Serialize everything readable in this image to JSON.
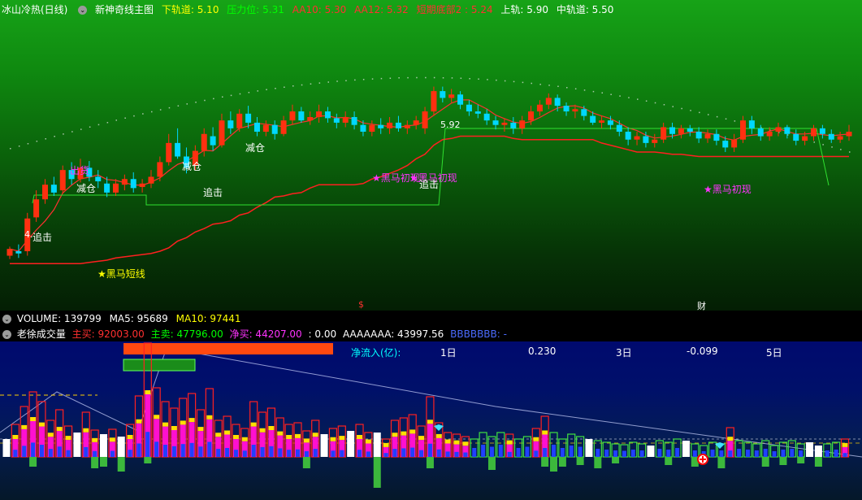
{
  "main_header": {
    "title": "冰山冷热(日线)",
    "indicator": "新神奇线主图",
    "items": [
      {
        "label": "下轨道: 5.10",
        "color": "#ffff00"
      },
      {
        "label": "压力位: 5.31",
        "color": "#00ff00"
      },
      {
        "label": "AA10: 5.30",
        "color": "#ff3030"
      },
      {
        "label": "AA12: 5.32",
        "color": "#ff3030"
      },
      {
        "label": "短期底部2 : 5.24",
        "color": "#ff3030"
      },
      {
        "label": "上轨: 5.90",
        "color": "#ffffff"
      },
      {
        "label": "中轨道: 5.50",
        "color": "#ffffff"
      }
    ]
  },
  "chart_labels": {
    "heima_short": "★黑马短线",
    "heima_appear_1": "★黑马初现",
    "heima_appear_2": "★黑马初现",
    "heima_appear_3": "★黑马初现",
    "zhuiji_1": "追击",
    "zhuiji_2": "追击",
    "zhuiji_3": "追击",
    "jiancang_1": "减仓",
    "jiancang_2": "减仓",
    "jiancang_3": "减仓",
    "chuhuo": "出货",
    "high_price": "5.92",
    "low_price": "4.",
    "marker_s": "$",
    "marker_cai": "财"
  },
  "volume_header": {
    "volume": "VOLUME: 139799",
    "ma5": "MA5: 95689",
    "ma10": "MA10: 97441"
  },
  "sub_header": {
    "title": "老徐成交量",
    "main_buy": "主买: 92003.00",
    "main_sell": "主卖: 47796.00",
    "net_buy": "净买: 44207.00",
    "zero": ": 0.00",
    "aaa": "AAAAAAA: 43997.56",
    "bbb": "BBBBBBB: -"
  },
  "net_inflow": {
    "label": "净流入(亿):",
    "d1": "1日",
    "v1": "0.230",
    "d3": "3日",
    "v3": "-0.099",
    "d5": "5日"
  },
  "chart_data": {
    "type": "candlestick",
    "ylim": [
      4.2,
      6.4
    ],
    "candles": [
      [
        4.42,
        4.48,
        4.39,
        4.5
      ],
      [
        4.46,
        4.44,
        4.4,
        4.52
      ],
      [
        4.46,
        4.75,
        4.42,
        4.8
      ],
      [
        4.76,
        4.92,
        4.72,
        5.0
      ],
      [
        4.92,
        5.05,
        4.88,
        5.1
      ],
      [
        5.05,
        4.98,
        4.95,
        5.12
      ],
      [
        5.0,
        5.18,
        4.97,
        5.22
      ],
      [
        5.18,
        5.1,
        5.05,
        5.25
      ],
      [
        5.1,
        5.2,
        5.07,
        5.28
      ],
      [
        5.2,
        5.12,
        5.08,
        5.26
      ],
      [
        5.12,
        5.08,
        5.02,
        5.18
      ],
      [
        5.06,
        4.98,
        4.94,
        5.12
      ],
      [
        4.98,
        5.06,
        4.95,
        5.1
      ],
      [
        5.05,
        5.1,
        5.0,
        5.14
      ],
      [
        5.1,
        5.02,
        4.98,
        5.16
      ],
      [
        5.03,
        5.06,
        4.98,
        5.1
      ],
      [
        5.06,
        5.12,
        5.02,
        5.18
      ],
      [
        5.12,
        5.25,
        5.08,
        5.3
      ],
      [
        5.25,
        5.42,
        5.22,
        5.5
      ],
      [
        5.42,
        5.3,
        5.28,
        5.55
      ],
      [
        5.3,
        5.2,
        5.15,
        5.38
      ],
      [
        5.22,
        5.35,
        5.18,
        5.4
      ],
      [
        5.35,
        5.5,
        5.3,
        5.55
      ],
      [
        5.48,
        5.4,
        5.35,
        5.56
      ],
      [
        5.4,
        5.62,
        5.38,
        5.68
      ],
      [
        5.62,
        5.55,
        5.5,
        5.7
      ],
      [
        5.55,
        5.68,
        5.52,
        5.72
      ],
      [
        5.68,
        5.6,
        5.55,
        5.75
      ],
      [
        5.6,
        5.52,
        5.48,
        5.65
      ],
      [
        5.52,
        5.58,
        5.48,
        5.62
      ],
      [
        5.58,
        5.5,
        5.45,
        5.62
      ],
      [
        5.5,
        5.62,
        5.48,
        5.66
      ],
      [
        5.62,
        5.7,
        5.58,
        5.76
      ],
      [
        5.7,
        5.62,
        5.6,
        5.74
      ],
      [
        5.62,
        5.65,
        5.58,
        5.7
      ],
      [
        5.65,
        5.7,
        5.6,
        5.76
      ],
      [
        5.7,
        5.64,
        5.6,
        5.74
      ],
      [
        5.64,
        5.6,
        5.55,
        5.68
      ],
      [
        5.6,
        5.65,
        5.56,
        5.7
      ],
      [
        5.65,
        5.58,
        5.54,
        5.7
      ],
      [
        5.58,
        5.52,
        5.48,
        5.62
      ],
      [
        5.52,
        5.58,
        5.48,
        5.62
      ],
      [
        5.58,
        5.55,
        5.5,
        5.64
      ],
      [
        5.55,
        5.6,
        5.5,
        5.65
      ],
      [
        5.6,
        5.55,
        5.52,
        5.66
      ],
      [
        5.55,
        5.58,
        5.5,
        5.62
      ],
      [
        5.58,
        5.62,
        5.54,
        5.66
      ],
      [
        5.55,
        5.7,
        5.5,
        5.74
      ],
      [
        5.7,
        5.88,
        5.66,
        5.92
      ],
      [
        5.88,
        5.82,
        5.78,
        5.92
      ],
      [
        5.82,
        5.85,
        5.78,
        5.9
      ],
      [
        5.85,
        5.76,
        5.72,
        5.88
      ],
      [
        5.76,
        5.7,
        5.66,
        5.8
      ],
      [
        5.7,
        5.68,
        5.64,
        5.76
      ],
      [
        5.68,
        5.62,
        5.58,
        5.72
      ],
      [
        5.62,
        5.58,
        5.54,
        5.66
      ],
      [
        5.58,
        5.6,
        5.52,
        5.64
      ],
      [
        5.6,
        5.55,
        5.5,
        5.65
      ],
      [
        5.55,
        5.62,
        5.5,
        5.66
      ],
      [
        5.62,
        5.7,
        5.58,
        5.75
      ],
      [
        5.7,
        5.76,
        5.66,
        5.8
      ],
      [
        5.76,
        5.82,
        5.72,
        5.86
      ],
      [
        5.82,
        5.75,
        5.7,
        5.85
      ],
      [
        5.75,
        5.7,
        5.66,
        5.78
      ],
      [
        5.7,
        5.72,
        5.64,
        5.76
      ],
      [
        5.72,
        5.66,
        5.62,
        5.75
      ],
      [
        5.66,
        5.6,
        5.58,
        5.7
      ],
      [
        5.6,
        5.62,
        5.55,
        5.66
      ],
      [
        5.62,
        5.58,
        5.54,
        5.66
      ],
      [
        5.58,
        5.52,
        5.48,
        5.62
      ],
      [
        5.52,
        5.45,
        5.4,
        5.56
      ],
      [
        5.45,
        5.48,
        5.4,
        5.52
      ],
      [
        5.48,
        5.42,
        5.38,
        5.52
      ],
      [
        5.42,
        5.45,
        5.38,
        5.5
      ],
      [
        5.45,
        5.56,
        5.42,
        5.6
      ],
      [
        5.56,
        5.5,
        5.46,
        5.6
      ],
      [
        5.5,
        5.55,
        5.46,
        5.58
      ],
      [
        5.55,
        5.52,
        5.48,
        5.58
      ],
      [
        5.52,
        5.46,
        5.42,
        5.56
      ],
      [
        5.46,
        5.5,
        5.42,
        5.54
      ],
      [
        5.5,
        5.44,
        5.4,
        5.54
      ],
      [
        5.44,
        5.38,
        5.34,
        5.48
      ],
      [
        5.38,
        5.45,
        5.34,
        5.5
      ],
      [
        5.45,
        5.62,
        5.42,
        5.66
      ],
      [
        5.62,
        5.55,
        5.5,
        5.66
      ],
      [
        5.55,
        5.48,
        5.44,
        5.58
      ],
      [
        5.48,
        5.52,
        5.44,
        5.56
      ],
      [
        5.52,
        5.56,
        5.48,
        5.6
      ],
      [
        5.56,
        5.5,
        5.46,
        5.58
      ],
      [
        5.5,
        5.44,
        5.4,
        5.54
      ],
      [
        5.44,
        5.48,
        5.4,
        5.52
      ],
      [
        5.48,
        5.55,
        5.44,
        5.58
      ],
      [
        5.55,
        5.5,
        5.46,
        5.58
      ],
      [
        5.5,
        5.45,
        5.42,
        5.54
      ],
      [
        5.45,
        5.48,
        5.42,
        5.52
      ],
      [
        5.48,
        5.52,
        5.44,
        5.58
      ]
    ],
    "volume": [
      {
        "h": 22,
        "c": "w"
      },
      {
        "h": 40,
        "c": "r"
      },
      {
        "h": 62,
        "c": "r"
      },
      {
        "h": 80,
        "c": "r"
      },
      {
        "h": 68,
        "c": "r"
      },
      {
        "h": 45,
        "c": "r"
      },
      {
        "h": 58,
        "c": "r"
      },
      {
        "h": 38,
        "c": "r"
      },
      {
        "h": 30,
        "c": "w"
      },
      {
        "h": 55,
        "c": "r"
      },
      {
        "h": 33,
        "c": "r"
      },
      {
        "h": 28,
        "c": "w"
      },
      {
        "h": 34,
        "c": "r"
      },
      {
        "h": 25,
        "c": "w"
      },
      {
        "h": 40,
        "c": "r"
      },
      {
        "h": 75,
        "c": "r"
      },
      {
        "h": 140,
        "c": "r"
      },
      {
        "h": 85,
        "c": "r"
      },
      {
        "h": 68,
        "c": "r"
      },
      {
        "h": 60,
        "c": "r"
      },
      {
        "h": 72,
        "c": "r"
      },
      {
        "h": 78,
        "c": "r"
      },
      {
        "h": 58,
        "c": "r"
      },
      {
        "h": 84,
        "c": "r"
      },
      {
        "h": 45,
        "c": "r"
      },
      {
        "h": 50,
        "c": "r"
      },
      {
        "h": 40,
        "c": "r"
      },
      {
        "h": 35,
        "c": "r"
      },
      {
        "h": 68,
        "c": "r"
      },
      {
        "h": 55,
        "c": "r"
      },
      {
        "h": 60,
        "c": "r"
      },
      {
        "h": 48,
        "c": "r"
      },
      {
        "h": 40,
        "c": "r"
      },
      {
        "h": 42,
        "c": "r"
      },
      {
        "h": 32,
        "c": "r"
      },
      {
        "h": 45,
        "c": "r"
      },
      {
        "h": 28,
        "c": "w"
      },
      {
        "h": 35,
        "c": "r"
      },
      {
        "h": 38,
        "c": "r"
      },
      {
        "h": 32,
        "c": "w"
      },
      {
        "h": 40,
        "c": "r"
      },
      {
        "h": 30,
        "c": "r"
      },
      {
        "h": 30,
        "c": "w"
      },
      {
        "h": 22,
        "c": "r"
      },
      {
        "h": 45,
        "c": "r"
      },
      {
        "h": 48,
        "c": "r"
      },
      {
        "h": 52,
        "c": "r"
      },
      {
        "h": 38,
        "c": "r"
      },
      {
        "h": 74,
        "c": "r"
      },
      {
        "h": 42,
        "c": "r"
      },
      {
        "h": 30,
        "c": "r"
      },
      {
        "h": 28,
        "c": "r"
      },
      {
        "h": 25,
        "c": "r"
      },
      {
        "h": 22,
        "c": "g"
      },
      {
        "h": 30,
        "c": "g"
      },
      {
        "h": 25,
        "c": "g"
      },
      {
        "h": 30,
        "c": "g"
      },
      {
        "h": 28,
        "c": "r"
      },
      {
        "h": 22,
        "c": "g"
      },
      {
        "h": 25,
        "c": "g"
      },
      {
        "h": 35,
        "c": "r"
      },
      {
        "h": 50,
        "c": "r"
      },
      {
        "h": 30,
        "c": "g"
      },
      {
        "h": 22,
        "c": "g"
      },
      {
        "h": 28,
        "c": "g"
      },
      {
        "h": 25,
        "c": "g"
      },
      {
        "h": 22,
        "c": "w"
      },
      {
        "h": 20,
        "c": "g"
      },
      {
        "h": 18,
        "c": "g"
      },
      {
        "h": 16,
        "c": "g"
      },
      {
        "h": 15,
        "c": "g"
      },
      {
        "h": 18,
        "c": "g"
      },
      {
        "h": 16,
        "c": "g"
      },
      {
        "h": 14,
        "c": "w"
      },
      {
        "h": 20,
        "c": "g"
      },
      {
        "h": 18,
        "c": "g"
      },
      {
        "h": 22,
        "c": "g"
      },
      {
        "h": 20,
        "c": "w"
      },
      {
        "h": 16,
        "c": "g"
      },
      {
        "h": 14,
        "c": "g"
      },
      {
        "h": 18,
        "c": "g"
      },
      {
        "h": 16,
        "c": "g"
      },
      {
        "h": 36,
        "c": "r"
      },
      {
        "h": 20,
        "c": "g"
      },
      {
        "h": 18,
        "c": "g"
      },
      {
        "h": 16,
        "c": "g"
      },
      {
        "h": 20,
        "c": "g"
      },
      {
        "h": 14,
        "c": "g"
      },
      {
        "h": 18,
        "c": "g"
      },
      {
        "h": 20,
        "c": "g"
      },
      {
        "h": 16,
        "c": "g"
      },
      {
        "h": 18,
        "c": "w"
      },
      {
        "h": 14,
        "c": "w"
      },
      {
        "h": 16,
        "c": "g"
      },
      {
        "h": 18,
        "c": "g"
      },
      {
        "h": 22,
        "c": "r"
      }
    ],
    "neg": [
      0,
      0,
      0,
      12,
      0,
      0,
      0,
      0,
      0,
      0,
      14,
      12,
      0,
      18,
      0,
      0,
      8,
      0,
      0,
      0,
      0,
      0,
      0,
      0,
      0,
      0,
      0,
      0,
      0,
      0,
      0,
      0,
      0,
      0,
      14,
      0,
      0,
      0,
      0,
      0,
      0,
      0,
      38,
      0,
      0,
      0,
      0,
      0,
      14,
      0,
      0,
      0,
      0,
      0,
      0,
      16,
      0,
      0,
      0,
      0,
      0,
      12,
      18,
      12,
      0,
      10,
      0,
      14,
      0,
      8,
      0,
      0,
      0,
      0,
      0,
      10,
      0,
      0,
      12,
      0,
      0,
      14,
      0,
      0,
      0,
      0,
      12,
      0,
      10,
      0,
      8,
      0,
      12,
      0,
      0,
      0
    ]
  }
}
